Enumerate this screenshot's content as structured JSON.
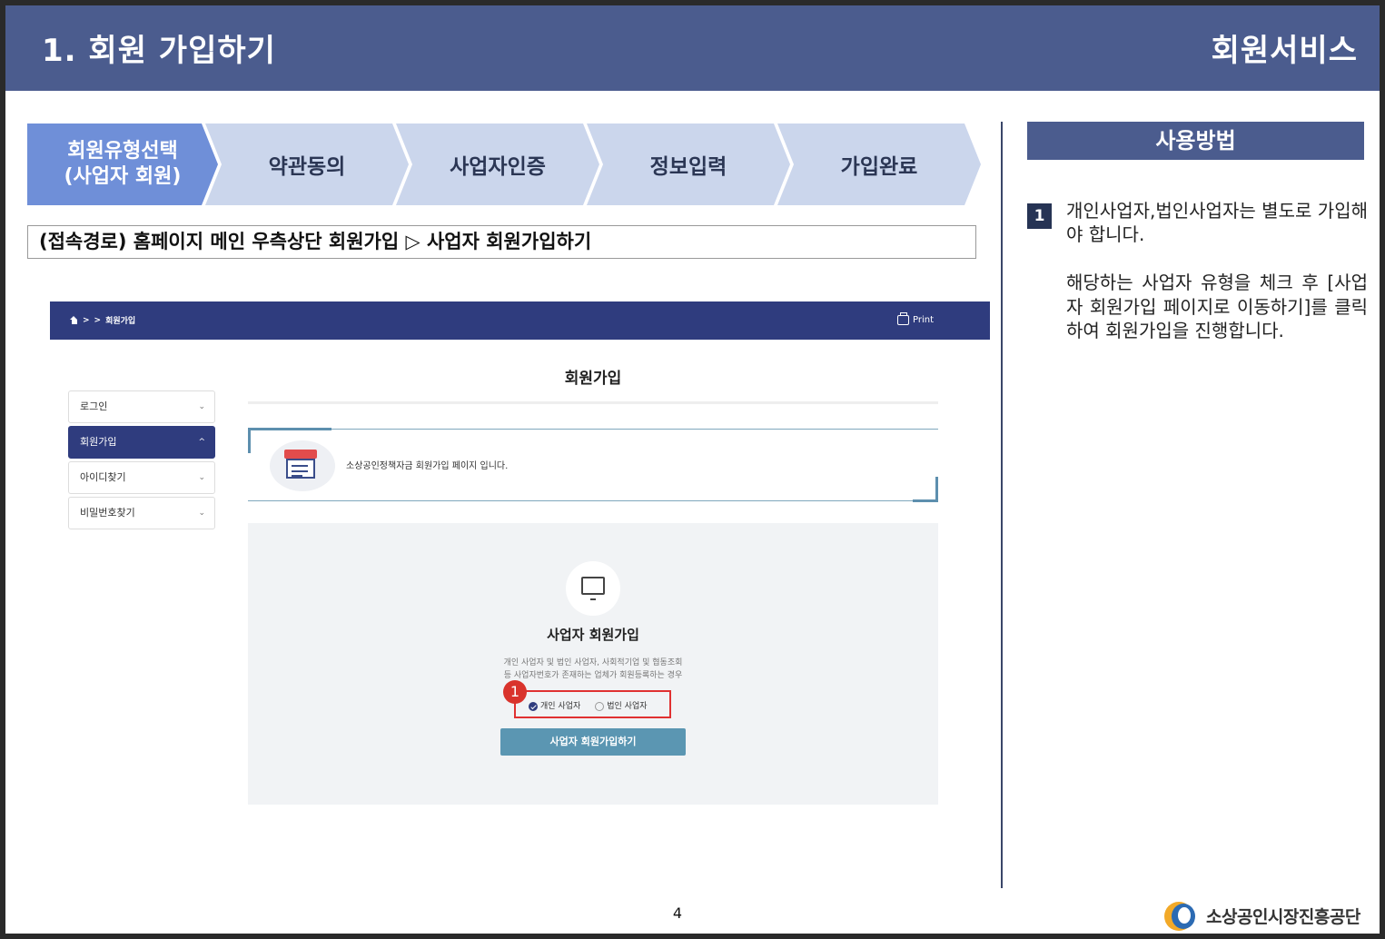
{
  "header": {
    "title": "1. 회원 가입하기",
    "service": "회원서비스"
  },
  "steps": [
    {
      "line1": "회원유형선택",
      "line2": "(사업자 회원)"
    },
    {
      "label": "약관동의"
    },
    {
      "label": "사업자인증"
    },
    {
      "label": "정보입력"
    },
    {
      "label": "가입완료"
    }
  ],
  "access_path": "(접속경로) 홈페이지 메인 우측상단 회원가입 ▷ 사업자 회원가입하기",
  "screenshot": {
    "breadcrumb": {
      "sep1": ">",
      "sep2": ">",
      "current": "회원가입"
    },
    "print_label": "Print",
    "section_title": "회원가입",
    "sidebar": [
      {
        "label": "로그인",
        "chevron": "⌄"
      },
      {
        "label": "회원가입",
        "chevron": "^"
      },
      {
        "label": "아이디찾기",
        "chevron": "⌄"
      },
      {
        "label": "비밀번호찾기",
        "chevron": "⌄"
      }
    ],
    "notice_text": "소상공인정책자금 회원가입 페이지 입니다.",
    "business": {
      "title": "사업자 회원가입",
      "desc_line1": "개인 사업자 및 법인 사업자, 사회적기업 및 협동조회",
      "desc_line2": "등 사업자번호가 존재하는 업체가 회원등록하는 경우",
      "options": [
        {
          "label": "개인 사업자",
          "selected": true
        },
        {
          "label": "법인 사업자",
          "selected": false
        }
      ],
      "marker": "1",
      "button_label": "사업자 회원가입하기"
    }
  },
  "howto": {
    "title": "사용방법",
    "step_number": "1",
    "line1": "개인사업자,법인사업자는  별도로 가입해야 합니다.",
    "line2": "해당하는 사업자 유형을 체크 후 [사업자 회원가입 페이지로 이동하기]를 클릭하여 회원가입을 진행합니다."
  },
  "footer": {
    "page_number": "4",
    "org_name": "소상공인시장진흥공단"
  },
  "colors": {
    "header_bg": "#4b5c8e",
    "step_active": "#6f8fd8",
    "step_inactive": "#cbd6ec",
    "navbar": "#2f3c7e",
    "highlight_red": "#e03131",
    "button": "#5b96b2"
  }
}
